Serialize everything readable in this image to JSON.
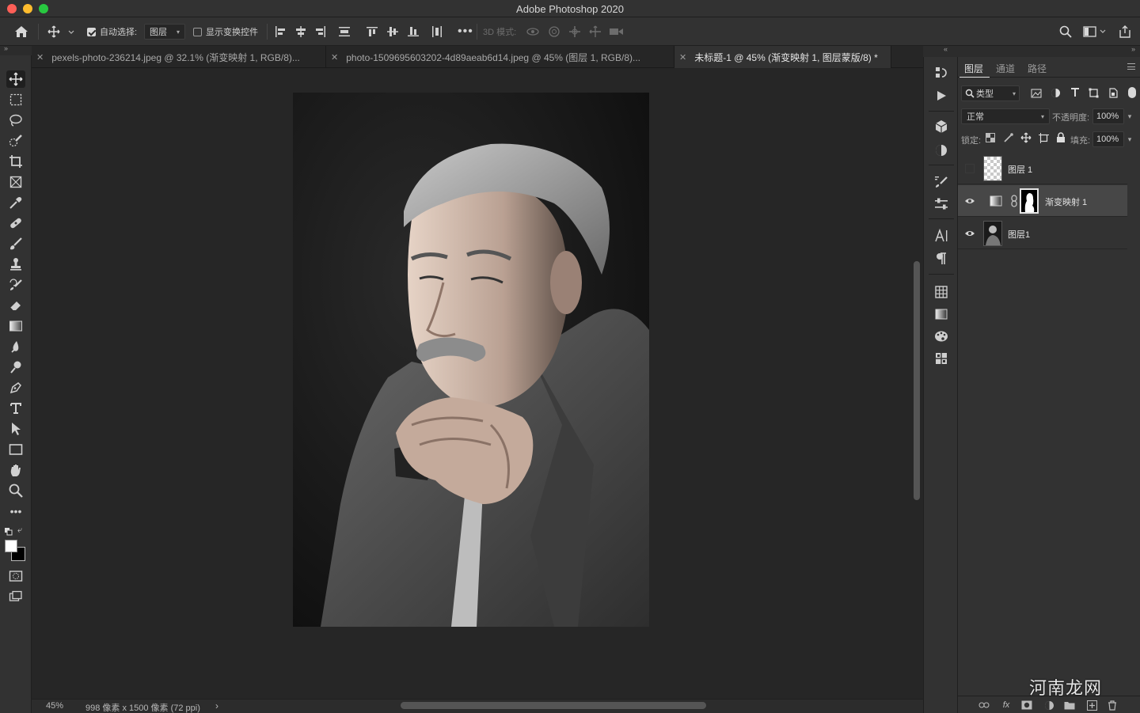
{
  "app": {
    "title": "Adobe Photoshop 2020"
  },
  "options_bar": {
    "auto_select_label": "自动选择:",
    "auto_select_checked": true,
    "auto_select_target": "图层",
    "show_transform_label": "显示变换控件",
    "show_transform_checked": false,
    "mode_3d_label": "3D 模式:"
  },
  "tabs": [
    {
      "label": "pexels-photo-236214.jpeg @ 32.1% (渐变映射 1, RGB/8)...",
      "active": false
    },
    {
      "label": "photo-1509695603202-4d89aeab6d14.jpeg @ 45% (图层 1, RGB/8)...",
      "active": false
    },
    {
      "label": "未标题-1 @ 45% (渐变映射 1, 图层蒙版/8) *",
      "active": true
    }
  ],
  "status_bar": {
    "zoom": "45%",
    "doc_info": "998 像素 x 1500 像素 (72 ppi)",
    "more_arrow": "›"
  },
  "layers_panel": {
    "tabs": [
      "图层",
      "通道",
      "路径"
    ],
    "filter_label": "类型",
    "blend_mode": "正常",
    "opacity_label": "不透明度:",
    "opacity_value": "100%",
    "lock_label": "锁定:",
    "fill_label": "填充:",
    "fill_value": "100%",
    "layers": [
      {
        "name": "图层 1",
        "visible": false,
        "type": "empty"
      },
      {
        "name": "渐变映射 1",
        "visible": true,
        "type": "adjustment",
        "selected": true
      },
      {
        "name": "图层1",
        "visible": true,
        "type": "photo"
      }
    ],
    "footer_fx": "fx"
  },
  "watermark": {
    "text": "河南龙网"
  },
  "colors": {
    "foreground": "#ffffff",
    "background": "#000000",
    "accent": "#474747"
  },
  "icons": {
    "toolbar": [
      "move-icon",
      "marquee-icon",
      "lasso-icon",
      "quick-select-icon",
      "crop-icon",
      "frame-icon",
      "eyedropper-icon",
      "healing-icon",
      "brush-icon",
      "stamp-icon",
      "history-brush-icon",
      "eraser-icon",
      "gradient-icon",
      "blur-icon",
      "dodge-icon",
      "pen-icon",
      "type-icon",
      "path-select-icon",
      "rectangle-icon",
      "hand-icon",
      "zoom-icon",
      "more-tools-icon"
    ]
  }
}
